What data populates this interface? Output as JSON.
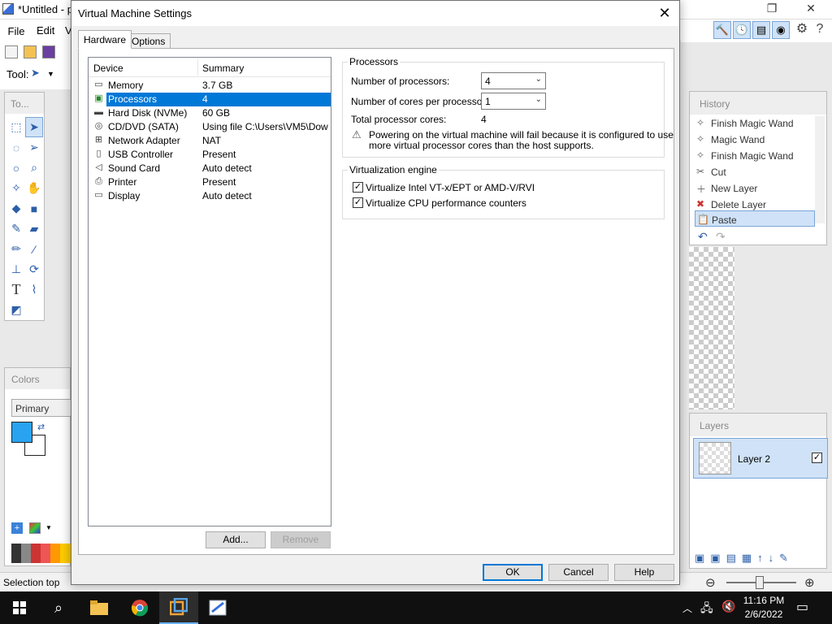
{
  "background_app": {
    "title": "*Untitled - p",
    "menu": [
      "File",
      "Edit",
      "V"
    ],
    "tool_label": "Tool:",
    "tools_panel_title": "To...",
    "colors_panel_title": "Colors",
    "primary_label": "Primary",
    "history_title": "History",
    "history_items": [
      "Finish Magic Wand",
      "Magic Wand",
      "Finish Magic Wand",
      "Cut",
      "New Layer",
      "Delete Layer",
      "Paste"
    ],
    "history_selected": "Paste",
    "layers_title": "Layers",
    "layer_name": "Layer 2",
    "status_text": "Selection top",
    "colors": {
      "primary": "#29a3f0",
      "secondary": "#ffffff"
    }
  },
  "dialog": {
    "title": "Virtual Machine Settings",
    "tabs": {
      "hardware": "Hardware",
      "options": "Options"
    },
    "device_header": {
      "device": "Device",
      "summary": "Summary"
    },
    "devices": [
      {
        "icon": "memory-icon",
        "name": "Memory",
        "summary": "3.7 GB"
      },
      {
        "icon": "processor-icon",
        "name": "Processors",
        "summary": "4"
      },
      {
        "icon": "hard-disk-icon",
        "name": "Hard Disk (NVMe)",
        "summary": "60 GB"
      },
      {
        "icon": "cd-dvd-icon",
        "name": "CD/DVD (SATA)",
        "summary": "Using file C:\\Users\\VM5\\Dow..."
      },
      {
        "icon": "network-icon",
        "name": "Network Adapter",
        "summary": "NAT"
      },
      {
        "icon": "usb-icon",
        "name": "USB Controller",
        "summary": "Present"
      },
      {
        "icon": "sound-icon",
        "name": "Sound Card",
        "summary": "Auto detect"
      },
      {
        "icon": "printer-icon",
        "name": "Printer",
        "summary": "Present"
      },
      {
        "icon": "display-icon",
        "name": "Display",
        "summary": "Auto detect"
      }
    ],
    "selected_device": "Processors",
    "buttons": {
      "add": "Add...",
      "remove": "Remove",
      "ok": "OK",
      "cancel": "Cancel",
      "help": "Help"
    },
    "processors": {
      "group_label": "Processors",
      "num_processors_label": "Number of processors:",
      "num_processors_value": "4",
      "cores_label": "Number of cores per processor:",
      "cores_value": "1",
      "total_label": "Total processor cores:",
      "total_value": "4",
      "warning_line1": "Powering on the virtual machine will fail because it is configured to use",
      "warning_line2": "more virtual processor cores than the host supports."
    },
    "virtualization": {
      "group_label": "Virtualization engine",
      "vtx_label": "Virtualize Intel VT-x/EPT or AMD-V/RVI",
      "vtx_checked": true,
      "cpu_counters_label": "Virtualize CPU performance counters",
      "cpu_counters_checked": true
    }
  },
  "taskbar": {
    "apps": [
      "file-explorer",
      "chrome",
      "vmware-workstation",
      "paint-net"
    ],
    "time": "11:16 PM",
    "date": "2/6/2022"
  }
}
